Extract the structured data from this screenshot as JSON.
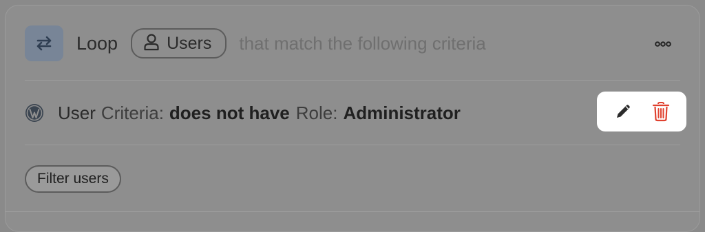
{
  "header": {
    "icon": "loop-arrows-icon",
    "title": "Loop",
    "entity_icon": "user-icon",
    "entity_label": "Users",
    "hint": "that match the following criteria",
    "menu_icon": "more-horizontal-icon"
  },
  "criteria": {
    "source_icon": "wordpress-icon",
    "subject": "User",
    "label": "Criteria:",
    "operator": "does not have",
    "field": "Role:",
    "value": "Administrator"
  },
  "actions": {
    "edit_icon": "pencil-icon",
    "delete_icon": "trash-icon",
    "delete_color": "#e0412f"
  },
  "footer": {
    "filter_label": "Filter users"
  },
  "colors": {
    "loop_icon_bg": "#788597",
    "overlay": "#8e8e8e"
  }
}
